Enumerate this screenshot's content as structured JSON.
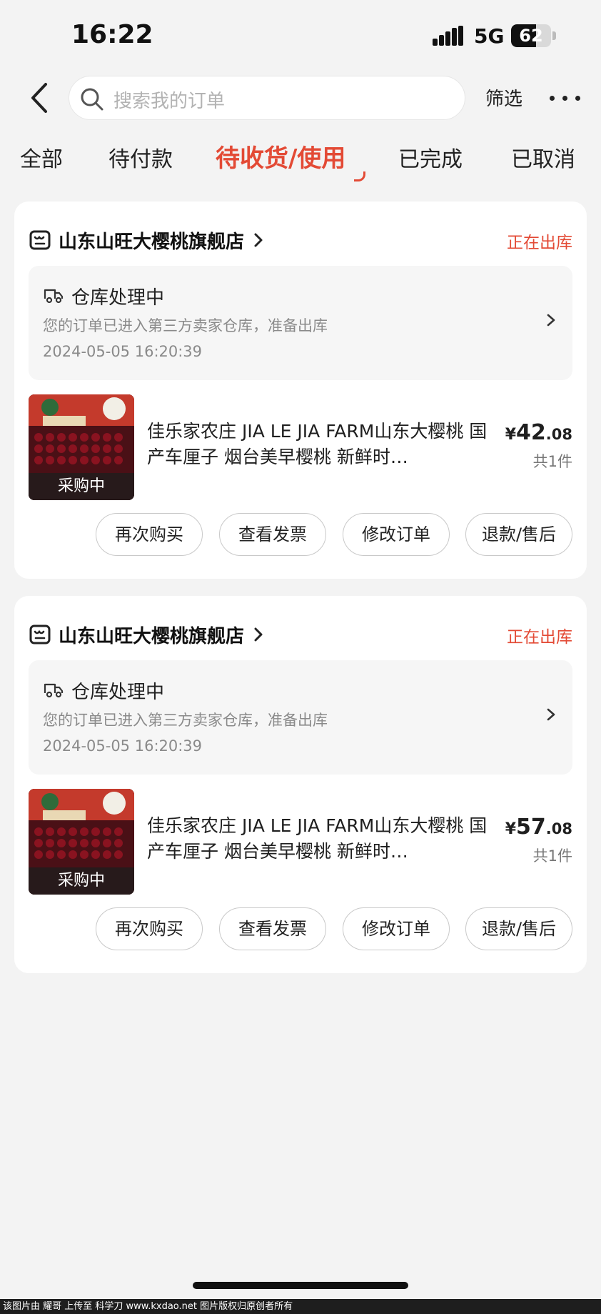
{
  "status_bar": {
    "time": "16:22",
    "network": "5G",
    "battery": "62",
    "battery_level": 0.62
  },
  "header": {
    "search_placeholder": "搜索我的订单",
    "filter_label": "筛选"
  },
  "tabs": [
    {
      "label": "全部",
      "active": false
    },
    {
      "label": "待付款",
      "active": false
    },
    {
      "label": "待收货/使用",
      "active": true
    },
    {
      "label": "已完成",
      "active": false
    },
    {
      "label": "已取消",
      "active": false
    }
  ],
  "orders": [
    {
      "store_name": "山东山旺大樱桃旗舰店",
      "status": "正在出库",
      "logistics_title": "仓库处理中",
      "logistics_desc": "您的订单已进入第三方卖家仓库，准备出库",
      "logistics_time": "2024-05-05 16:20:39",
      "product_badge": "采购中",
      "product_title": "佳乐家农庄 JIA LE JIA FARM山东大樱桃 国产车厘子 烟台美早樱桃  新鲜时…",
      "price_currency": "¥",
      "price_int": "42",
      "price_dec": ".08",
      "quantity": "共1件",
      "actions": [
        "再次购买",
        "查看发票",
        "修改订单",
        "退款/售后"
      ]
    },
    {
      "store_name": "山东山旺大樱桃旗舰店",
      "status": "正在出库",
      "logistics_title": "仓库处理中",
      "logistics_desc": "您的订单已进入第三方卖家仓库，准备出库",
      "logistics_time": "2024-05-05 16:20:39",
      "product_badge": "采购中",
      "product_title": "佳乐家农庄 JIA LE JIA FARM山东大樱桃 国产车厘子 烟台美早樱桃  新鲜时…",
      "price_currency": "¥",
      "price_int": "57",
      "price_dec": ".08",
      "quantity": "共1件",
      "actions": [
        "再次购买",
        "查看发票",
        "修改订单",
        "退款/售后"
      ]
    }
  ],
  "watermark": "该图片由 耀哥 上传至 科学刀 www.kxdao.net 图片版权归原创者所有",
  "colors": {
    "accent": "#e34a35",
    "background": "#f3f3f3"
  }
}
